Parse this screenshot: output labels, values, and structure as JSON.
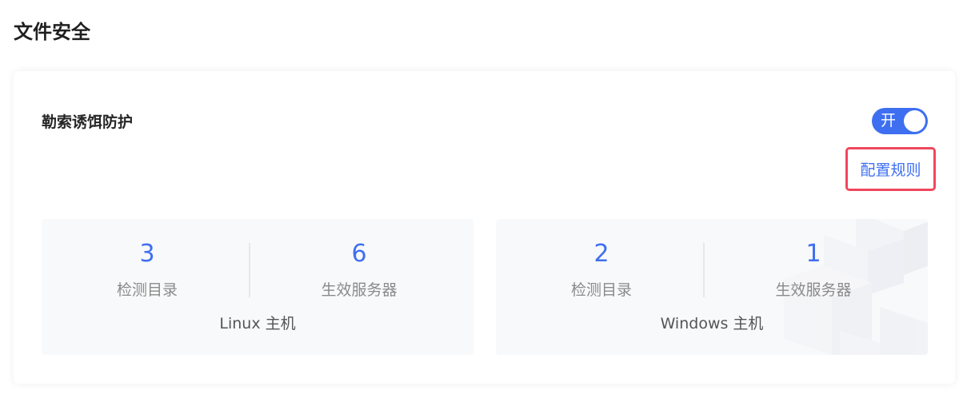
{
  "page": {
    "title": "文件安全"
  },
  "ransomware": {
    "title": "勒索诱饵防护",
    "toggle_label": "开",
    "config_link": "配置规则"
  },
  "linux": {
    "dirs_count": "3",
    "dirs_label": "检测目录",
    "servers_count": "6",
    "servers_label": "生效服务器",
    "host_label": "Linux 主机"
  },
  "windows": {
    "dirs_count": "2",
    "dirs_label": "检测目录",
    "servers_count": "1",
    "servers_label": "生效服务器",
    "host_label": "Windows 主机"
  },
  "colors": {
    "accent": "#3e6ff0",
    "highlight_border": "#f0475d",
    "panel_bg": "#f8f9fa"
  }
}
